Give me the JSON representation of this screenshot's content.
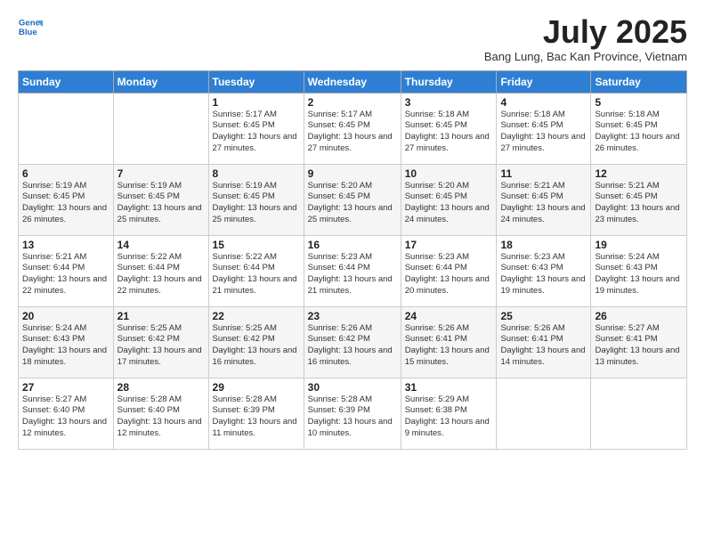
{
  "logo": {
    "line1": "General",
    "line2": "Blue"
  },
  "title": "July 2025",
  "location": "Bang Lung, Bac Kan Province, Vietnam",
  "weekdays": [
    "Sunday",
    "Monday",
    "Tuesday",
    "Wednesday",
    "Thursday",
    "Friday",
    "Saturday"
  ],
  "weeks": [
    [
      {
        "day": "",
        "sunrise": "",
        "sunset": "",
        "daylight": ""
      },
      {
        "day": "",
        "sunrise": "",
        "sunset": "",
        "daylight": ""
      },
      {
        "day": "1",
        "sunrise": "Sunrise: 5:17 AM",
        "sunset": "Sunset: 6:45 PM",
        "daylight": "Daylight: 13 hours and 27 minutes."
      },
      {
        "day": "2",
        "sunrise": "Sunrise: 5:17 AM",
        "sunset": "Sunset: 6:45 PM",
        "daylight": "Daylight: 13 hours and 27 minutes."
      },
      {
        "day": "3",
        "sunrise": "Sunrise: 5:18 AM",
        "sunset": "Sunset: 6:45 PM",
        "daylight": "Daylight: 13 hours and 27 minutes."
      },
      {
        "day": "4",
        "sunrise": "Sunrise: 5:18 AM",
        "sunset": "Sunset: 6:45 PM",
        "daylight": "Daylight: 13 hours and 27 minutes."
      },
      {
        "day": "5",
        "sunrise": "Sunrise: 5:18 AM",
        "sunset": "Sunset: 6:45 PM",
        "daylight": "Daylight: 13 hours and 26 minutes."
      }
    ],
    [
      {
        "day": "6",
        "sunrise": "Sunrise: 5:19 AM",
        "sunset": "Sunset: 6:45 PM",
        "daylight": "Daylight: 13 hours and 26 minutes."
      },
      {
        "day": "7",
        "sunrise": "Sunrise: 5:19 AM",
        "sunset": "Sunset: 6:45 PM",
        "daylight": "Daylight: 13 hours and 25 minutes."
      },
      {
        "day": "8",
        "sunrise": "Sunrise: 5:19 AM",
        "sunset": "Sunset: 6:45 PM",
        "daylight": "Daylight: 13 hours and 25 minutes."
      },
      {
        "day": "9",
        "sunrise": "Sunrise: 5:20 AM",
        "sunset": "Sunset: 6:45 PM",
        "daylight": "Daylight: 13 hours and 25 minutes."
      },
      {
        "day": "10",
        "sunrise": "Sunrise: 5:20 AM",
        "sunset": "Sunset: 6:45 PM",
        "daylight": "Daylight: 13 hours and 24 minutes."
      },
      {
        "day": "11",
        "sunrise": "Sunrise: 5:21 AM",
        "sunset": "Sunset: 6:45 PM",
        "daylight": "Daylight: 13 hours and 24 minutes."
      },
      {
        "day": "12",
        "sunrise": "Sunrise: 5:21 AM",
        "sunset": "Sunset: 6:45 PM",
        "daylight": "Daylight: 13 hours and 23 minutes."
      }
    ],
    [
      {
        "day": "13",
        "sunrise": "Sunrise: 5:21 AM",
        "sunset": "Sunset: 6:44 PM",
        "daylight": "Daylight: 13 hours and 22 minutes."
      },
      {
        "day": "14",
        "sunrise": "Sunrise: 5:22 AM",
        "sunset": "Sunset: 6:44 PM",
        "daylight": "Daylight: 13 hours and 22 minutes."
      },
      {
        "day": "15",
        "sunrise": "Sunrise: 5:22 AM",
        "sunset": "Sunset: 6:44 PM",
        "daylight": "Daylight: 13 hours and 21 minutes."
      },
      {
        "day": "16",
        "sunrise": "Sunrise: 5:23 AM",
        "sunset": "Sunset: 6:44 PM",
        "daylight": "Daylight: 13 hours and 21 minutes."
      },
      {
        "day": "17",
        "sunrise": "Sunrise: 5:23 AM",
        "sunset": "Sunset: 6:44 PM",
        "daylight": "Daylight: 13 hours and 20 minutes."
      },
      {
        "day": "18",
        "sunrise": "Sunrise: 5:23 AM",
        "sunset": "Sunset: 6:43 PM",
        "daylight": "Daylight: 13 hours and 19 minutes."
      },
      {
        "day": "19",
        "sunrise": "Sunrise: 5:24 AM",
        "sunset": "Sunset: 6:43 PM",
        "daylight": "Daylight: 13 hours and 19 minutes."
      }
    ],
    [
      {
        "day": "20",
        "sunrise": "Sunrise: 5:24 AM",
        "sunset": "Sunset: 6:43 PM",
        "daylight": "Daylight: 13 hours and 18 minutes."
      },
      {
        "day": "21",
        "sunrise": "Sunrise: 5:25 AM",
        "sunset": "Sunset: 6:42 PM",
        "daylight": "Daylight: 13 hours and 17 minutes."
      },
      {
        "day": "22",
        "sunrise": "Sunrise: 5:25 AM",
        "sunset": "Sunset: 6:42 PM",
        "daylight": "Daylight: 13 hours and 16 minutes."
      },
      {
        "day": "23",
        "sunrise": "Sunrise: 5:26 AM",
        "sunset": "Sunset: 6:42 PM",
        "daylight": "Daylight: 13 hours and 16 minutes."
      },
      {
        "day": "24",
        "sunrise": "Sunrise: 5:26 AM",
        "sunset": "Sunset: 6:41 PM",
        "daylight": "Daylight: 13 hours and 15 minutes."
      },
      {
        "day": "25",
        "sunrise": "Sunrise: 5:26 AM",
        "sunset": "Sunset: 6:41 PM",
        "daylight": "Daylight: 13 hours and 14 minutes."
      },
      {
        "day": "26",
        "sunrise": "Sunrise: 5:27 AM",
        "sunset": "Sunset: 6:41 PM",
        "daylight": "Daylight: 13 hours and 13 minutes."
      }
    ],
    [
      {
        "day": "27",
        "sunrise": "Sunrise: 5:27 AM",
        "sunset": "Sunset: 6:40 PM",
        "daylight": "Daylight: 13 hours and 12 minutes."
      },
      {
        "day": "28",
        "sunrise": "Sunrise: 5:28 AM",
        "sunset": "Sunset: 6:40 PM",
        "daylight": "Daylight: 13 hours and 12 minutes."
      },
      {
        "day": "29",
        "sunrise": "Sunrise: 5:28 AM",
        "sunset": "Sunset: 6:39 PM",
        "daylight": "Daylight: 13 hours and 11 minutes."
      },
      {
        "day": "30",
        "sunrise": "Sunrise: 5:28 AM",
        "sunset": "Sunset: 6:39 PM",
        "daylight": "Daylight: 13 hours and 10 minutes."
      },
      {
        "day": "31",
        "sunrise": "Sunrise: 5:29 AM",
        "sunset": "Sunset: 6:38 PM",
        "daylight": "Daylight: 13 hours and 9 minutes."
      },
      {
        "day": "",
        "sunrise": "",
        "sunset": "",
        "daylight": ""
      },
      {
        "day": "",
        "sunrise": "",
        "sunset": "",
        "daylight": ""
      }
    ]
  ]
}
